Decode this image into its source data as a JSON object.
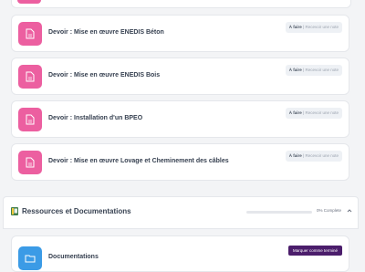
{
  "activities": [
    {
      "title": "Devoir : Mise en œuvre ENEDIS Béton",
      "status": "À faire",
      "requirement": "Recevoir une note"
    },
    {
      "title": "Devoir : Mise en œuvre ENEDIS Bois",
      "status": "À faire",
      "requirement": "Recevoir une note"
    },
    {
      "title": "Devoir : Installation d'un BPEO",
      "status": "À faire",
      "requirement": "Recevoir une note"
    },
    {
      "title": "Devoir : Mise en œuvre Lovage et Cheminement des câbles",
      "status": "À faire",
      "requirement": "Recevoir une note"
    }
  ],
  "section": {
    "title": "Ressources et Documentations",
    "progress_text": "0% Complete",
    "progress": 0,
    "items": [
      {
        "title": "Documentations",
        "action": "Marquer comme terminé"
      }
    ]
  },
  "colors": {
    "assignment_icon": "#ec5fa0",
    "resource_icon": "#3b9be6",
    "mark_button": "#4b1d6b",
    "progress_fill": "#10b981"
  }
}
